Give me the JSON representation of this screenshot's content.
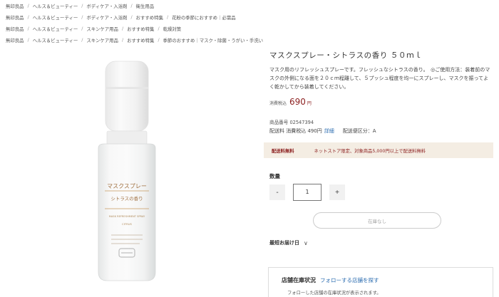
{
  "breadcrumbs": [
    [
      "無印良品",
      "ヘルス＆ビューティー",
      "ボディケア・入浴剤",
      "衛生用品"
    ],
    [
      "無印良品",
      "ヘルス＆ビューティー",
      "ボディケア・入浴剤",
      "おすすめ特集",
      "花粉の季節におすすめ｜必需品"
    ],
    [
      "無印良品",
      "ヘルス＆ビューティー",
      "スキンケア用品",
      "おすすめ特集",
      "乾燥対策"
    ],
    [
      "無印良品",
      "ヘルス＆ビューティー",
      "スキンケア用品",
      "おすすめ特集",
      "季節のおすすめ｜マスク・除菌・うがい・手洗い"
    ]
  ],
  "product": {
    "title": "マスクスプレー・シトラスの香り ５０ｍｌ",
    "description": "マスク用のリフレッシュスプレーです。フレッシュなシトラスの香り。　◎ご使用方法：装着前のマスクの外側になる面を２０ｃｍ程離して、５プッシュ程度を均一にスプレーし、マスクを振ってよく乾かしてから装着してください。",
    "price_label": "消費税込",
    "price": "690",
    "price_unit": "円",
    "product_number": "商品番号 02547394",
    "shipping_fee": "配送料 消費税込 490円",
    "shipping_link": "詳細",
    "shipping_class": "配送便区分：A",
    "image_label_jp": "マスクスプレー",
    "image_label_sub": "シトラスの香り",
    "image_label_en": "MASK REFRESHMENT SPRAY",
    "image_label_en2": "CITRUS"
  },
  "free_shipping": {
    "tag": "配送料無料",
    "note": "ネットストア限定、対象商品5,000円以上で配送料無料"
  },
  "quantity": {
    "label": "数量",
    "value": "1",
    "minus": "-",
    "plus": "+"
  },
  "cart_button": "在庫なし",
  "delivery": {
    "label": "最短お届け日",
    "chevron": "∨"
  },
  "store": {
    "title": "店舗在庫状況",
    "follow_link": "フォローする店舗を探す",
    "note": "フォローした店舗の在庫状況が表示されます。"
  },
  "colors": {
    "price": "#8b1e1e",
    "link": "#2b6cb0",
    "banner_bg": "#f4ede3"
  }
}
